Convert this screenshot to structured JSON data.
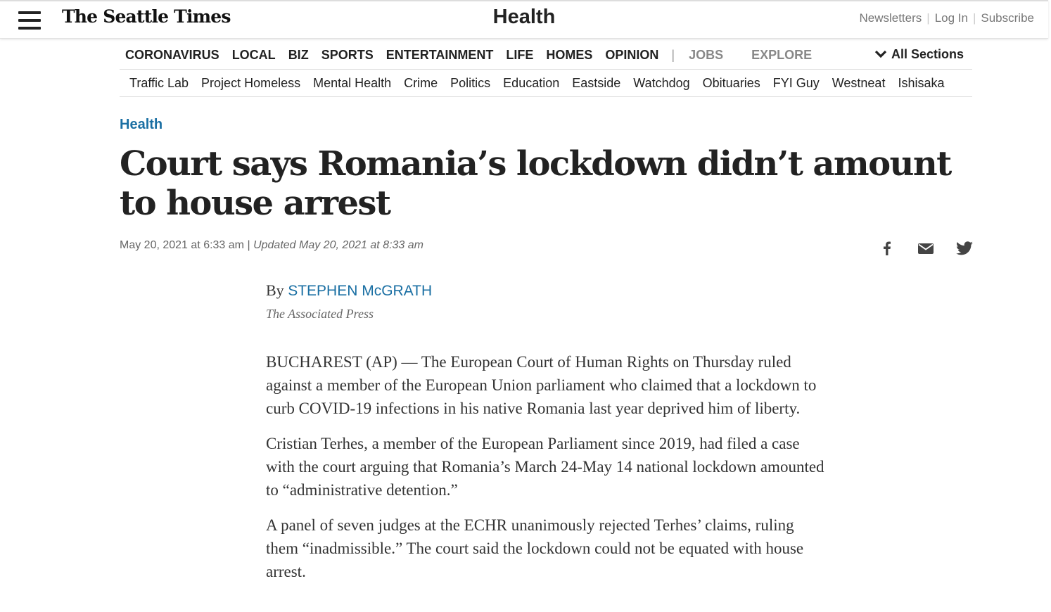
{
  "header": {
    "logo": "The Seattle Times",
    "section_title": "Health",
    "utility_links": [
      "Newsletters",
      "Log In",
      "Subscribe"
    ]
  },
  "primary_nav": {
    "items": [
      "CORONAVIRUS",
      "LOCAL",
      "BIZ",
      "SPORTS",
      "ENTERTAINMENT",
      "LIFE",
      "HOMES",
      "OPINION"
    ],
    "divider": "|",
    "muted_items": [
      "JOBS",
      "EXPLORE"
    ],
    "all_sections": "All Sections"
  },
  "secondary_nav": {
    "items": [
      "Traffic Lab",
      "Project Homeless",
      "Mental Health",
      "Crime",
      "Politics",
      "Education",
      "Eastside",
      "Watchdog",
      "Obituaries",
      "FYI Guy",
      "Westneat",
      "Ishisaka"
    ]
  },
  "article": {
    "kicker": "Health",
    "headline": "Court says Romania’s lockdown didn’t amount to house arrest",
    "published": "May 20, 2021 at 6:33 am",
    "separator": "|",
    "updated": "Updated May 20, 2021 at 8:33 am",
    "byline_prefix": "By",
    "author": "STEPHEN McGRATH",
    "organization": "The Associated Press",
    "paragraphs": [
      "BUCHAREST (AP) — The European Court of Human Rights on Thursday ruled against a member of the European Union parliament who claimed that a lockdown to curb COVID-19 infections in his native Romania last year deprived him of liberty.",
      "Cristian Terhes, a member of the European Parliament since 2019, had filed a case with the court arguing that Romania’s March 24-May 14 national lockdown amounted to “administrative detention.”",
      "A panel of seven judges at the ECHR unanimously rejected Terhes’ claims, ruling them “inadmissible.” The court said the lockdown could not be equated with house arrest."
    ]
  },
  "share_icons": [
    "facebook-icon",
    "email-icon",
    "twitter-icon"
  ],
  "colors": {
    "link_blue": "#1a6fa3",
    "text": "#222222",
    "muted": "#888888"
  }
}
